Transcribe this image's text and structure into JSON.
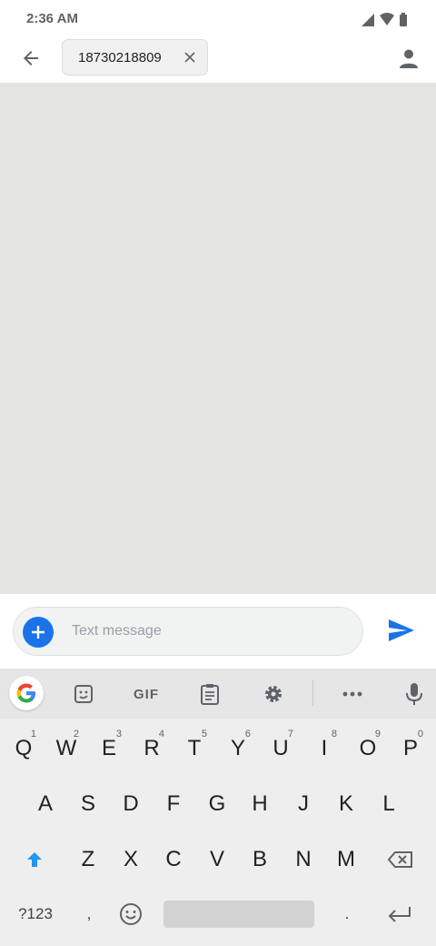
{
  "status_bar": {
    "time": "2:36 AM",
    "icons": [
      "signal-icon",
      "wifi-icon",
      "battery-icon"
    ]
  },
  "header": {
    "back_icon": "arrow-left-icon",
    "recipient_chip": {
      "text": "18730218809",
      "remove_icon": "close-icon"
    },
    "contact_icon": "person-icon"
  },
  "compose": {
    "add_icon": "plus-icon",
    "placeholder": "Text message",
    "value": "",
    "send_icon": "send-icon"
  },
  "keyboard": {
    "toolbar": [
      "google-icon",
      "sticker-icon",
      "GIF",
      "clipboard-icon",
      "gear-icon",
      "more-icon",
      "mic-icon"
    ],
    "gif_label": "GIF",
    "row1": [
      "Q",
      "W",
      "E",
      "R",
      "T",
      "Y",
      "U",
      "I",
      "O",
      "P"
    ],
    "row1_hints": [
      "1",
      "2",
      "3",
      "4",
      "5",
      "6",
      "7",
      "8",
      "9",
      "0"
    ],
    "row2": [
      "A",
      "S",
      "D",
      "F",
      "G",
      "H",
      "J",
      "K",
      "L"
    ],
    "row3": [
      "Z",
      "X",
      "C",
      "V",
      "B",
      "N",
      "M"
    ],
    "bottom": {
      "symbols": "?123",
      "comma": ",",
      "period": "."
    }
  },
  "colors": {
    "accent": "#1a73e8",
    "thread_bg": "#e4e5e3",
    "keyboard_bg": "#eeeeee"
  }
}
